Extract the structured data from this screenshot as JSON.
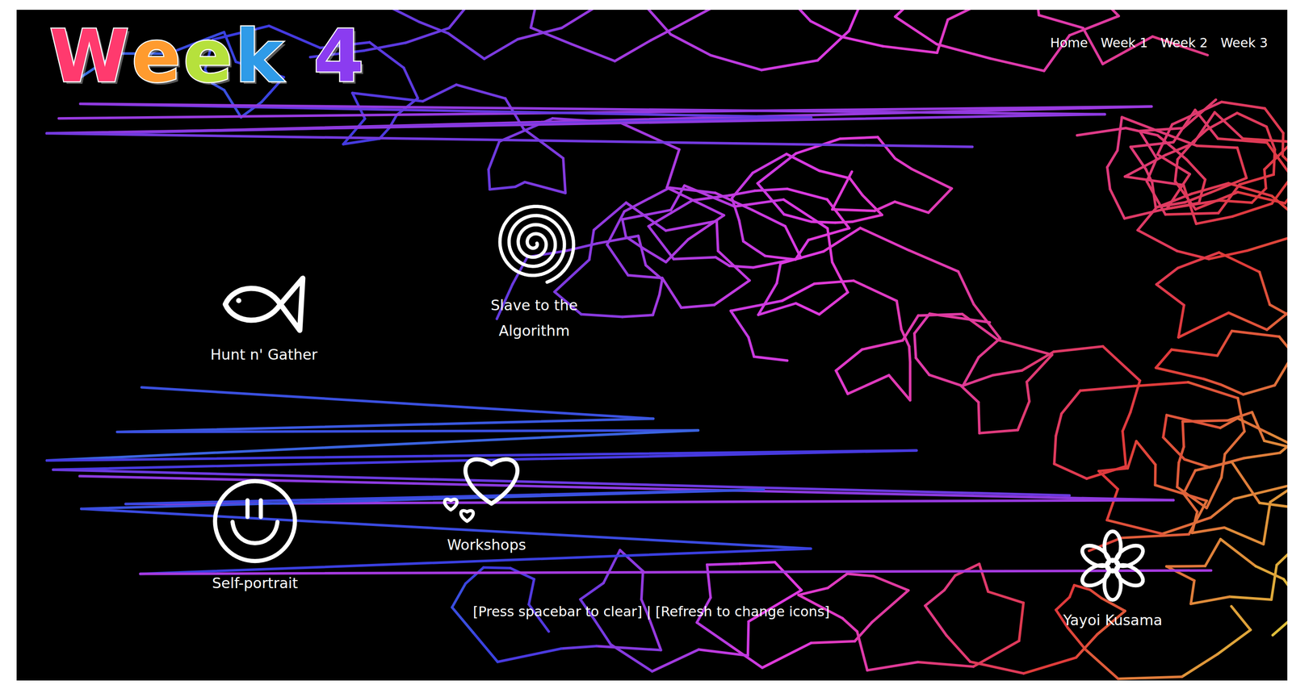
{
  "logo": {
    "text": "Week 4"
  },
  "nav": [
    {
      "label": "Home"
    },
    {
      "label": "Week 1"
    },
    {
      "label": "Week 2"
    },
    {
      "label": "Week 3"
    }
  ],
  "icons": [
    {
      "label": "Hunt n' Gather"
    },
    {
      "label": "Slave to the Algorithm"
    },
    {
      "label": "Workshops"
    },
    {
      "label": "Self-portrait"
    },
    {
      "label": "Yayoi Kusama"
    }
  ],
  "hint": "[Press spacebar to clear] | [Refresh to change icons]"
}
